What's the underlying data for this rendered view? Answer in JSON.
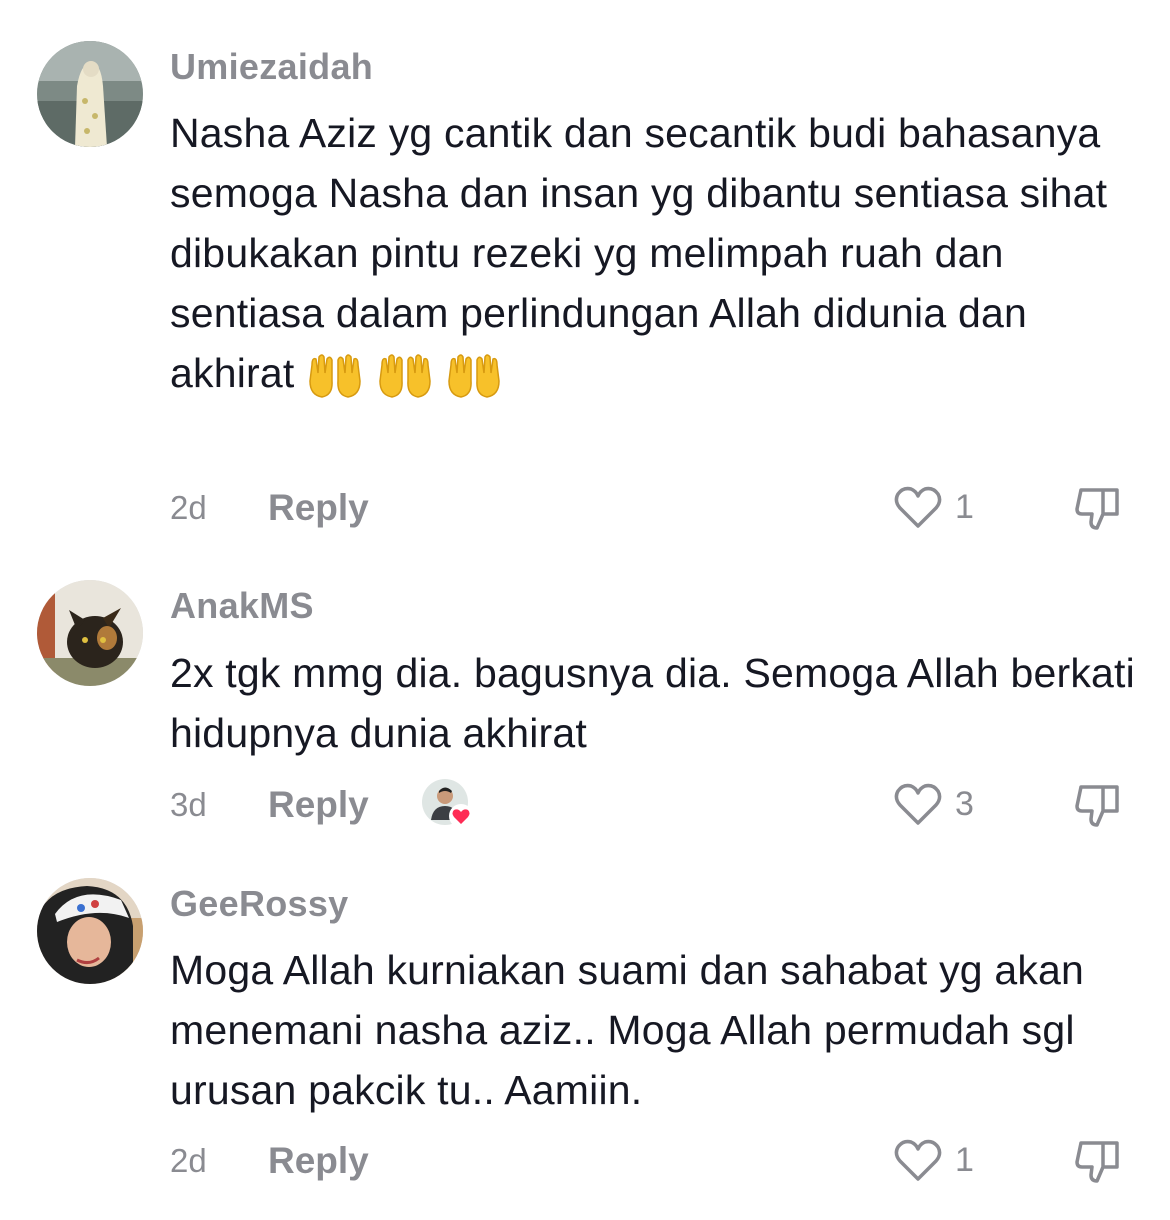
{
  "comments": [
    {
      "username": "Umiezaidah",
      "text": "Nasha Aziz yg cantik dan secantik budi bahasanya semoga Nasha dan insan yg dibantu sentiasa sihat dibukakan pintu rezeki yg melimpah ruah dan sentiasa dalam perlindungan Allah didunia dan akhirat",
      "emoji_count": 3,
      "emoji_icon": "open-hands-emoji",
      "time": "2d",
      "reply_label": "Reply",
      "likes": "1"
    },
    {
      "username": "AnakMS",
      "text": "2x tgk mmg dia. bagusnya dia. Semoga Allah berkati hidupnya dunia akhirat",
      "time": "3d",
      "reply_label": "Reply",
      "creator_liked": true,
      "likes": "3"
    },
    {
      "username": "GeeRossy",
      "text": "Moga Allah kurniakan suami dan sahabat yg akan menemani nasha aziz.. Moga Allah permudah sgl urusan pakcik tu.. Aamiin.",
      "time": "2d",
      "reply_label": "Reply",
      "likes": "1"
    }
  ],
  "icons": {
    "like": "heart-outline-icon",
    "dislike": "thumbs-down-icon"
  },
  "colors": {
    "username": "#8a8b91",
    "text": "#161823",
    "creator_heart": "#fe2c55"
  }
}
